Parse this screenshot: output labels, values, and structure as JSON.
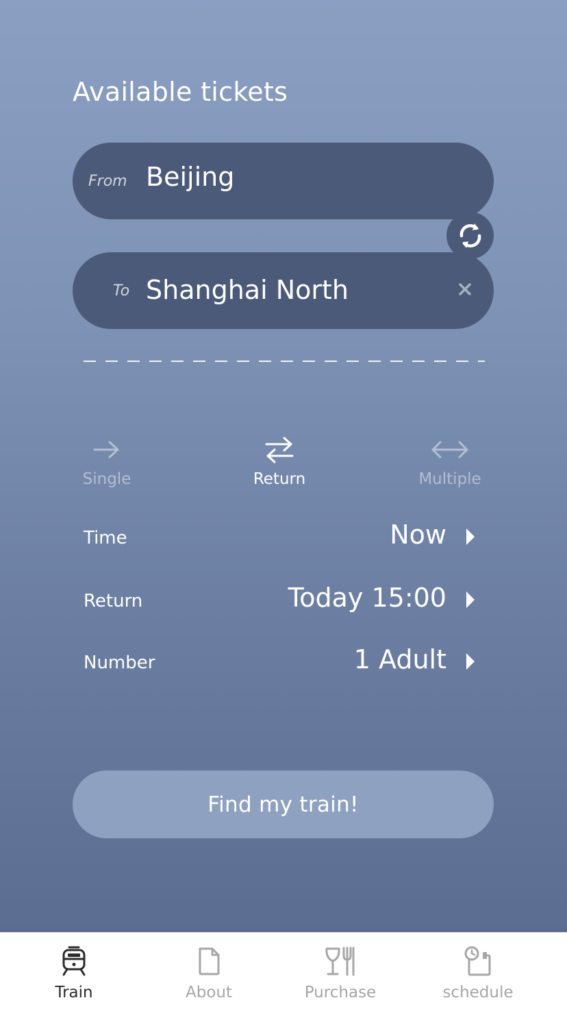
{
  "header": {
    "title": "Available tickets"
  },
  "route": {
    "from_label": "From",
    "from_value": "Beijing",
    "to_label": "To",
    "to_value": "Shanghai North"
  },
  "trip_types": [
    {
      "label": "Single",
      "icon": "arrow-right-icon",
      "active": false
    },
    {
      "label": "Return",
      "icon": "swap-arrows-icon",
      "active": true
    },
    {
      "label": "Multiple",
      "icon": "arrow-both-icon",
      "active": false
    }
  ],
  "options": {
    "time_label": "Time",
    "time_value": "Now",
    "return_label": "Return",
    "return_value": "Today 15:00",
    "number_label": "Number",
    "number_value": "1 Adult"
  },
  "action": {
    "find_label": "Find my train!"
  },
  "tabbar": {
    "items": [
      {
        "label": "Train",
        "icon": "train-icon",
        "active": true
      },
      {
        "label": "About",
        "icon": "document-icon",
        "active": false
      },
      {
        "label": "Purchase",
        "icon": "dining-icon",
        "active": false
      },
      {
        "label": "schedule",
        "icon": "schedule-icon",
        "active": false
      }
    ]
  },
  "colors": {
    "gradient_top": "#8a9fc1",
    "gradient_bottom": "#5b6d91",
    "field_bg": "#4b5a78",
    "button_bg": "#8fa1c0",
    "tab_active": "#2b2b2b",
    "tab_inactive": "#a6a6a6"
  }
}
